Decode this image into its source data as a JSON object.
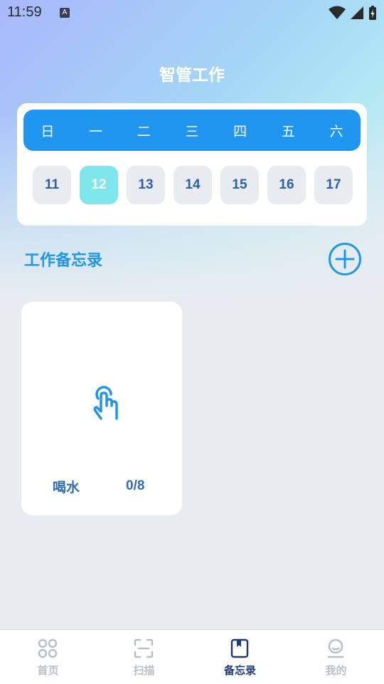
{
  "status_bar": {
    "time": "11:59",
    "notification_icon": "A"
  },
  "header": {
    "title": "智管工作"
  },
  "calendar": {
    "weekdays": [
      "日",
      "一",
      "二",
      "三",
      "四",
      "五",
      "六"
    ],
    "dates": [
      "11",
      "12",
      "13",
      "14",
      "15",
      "16",
      "17"
    ],
    "selected_date": "12"
  },
  "memo_section": {
    "title": "工作备忘录",
    "add_icon": "plus-circle-icon"
  },
  "memo_cards": [
    {
      "icon": "tap-hand-icon",
      "name": "喝水",
      "count": "0/8"
    }
  ],
  "tabbar": {
    "items": [
      {
        "label": "首页",
        "icon": "clover-icon",
        "active": false
      },
      {
        "label": "扫描",
        "icon": "scan-icon",
        "active": false
      },
      {
        "label": "备忘录",
        "icon": "notebook-icon",
        "active": true
      },
      {
        "label": "我的",
        "icon": "user-icon",
        "active": false
      }
    ]
  },
  "colors": {
    "accent": "#2196f0",
    "selected_date": "#7fe7ec",
    "text_blue": "#2d6eb4",
    "tab_active": "#1d3a78",
    "tab_inactive": "#b9bfc7"
  }
}
